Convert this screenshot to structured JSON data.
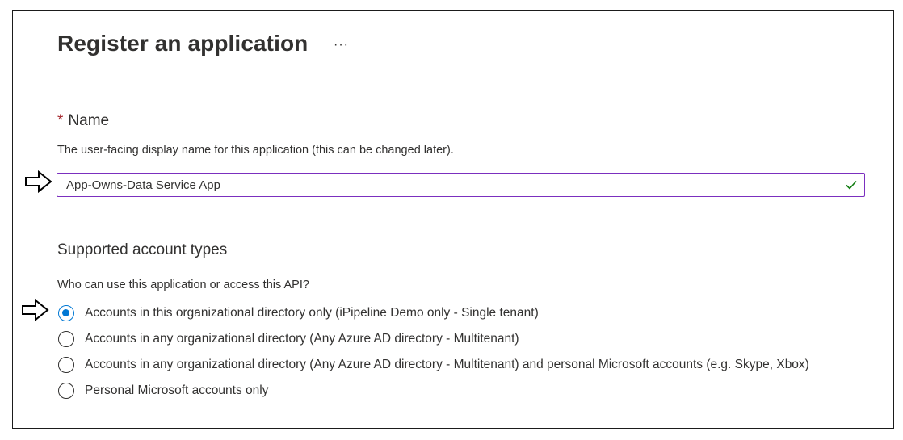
{
  "page": {
    "title": "Register an application",
    "more_label": "···"
  },
  "name_section": {
    "required_marker": "*",
    "label": "Name",
    "description": "The user-facing display name for this application (this can be changed later).",
    "input_value": "App-Owns-Data Service App",
    "valid_icon": "check-icon"
  },
  "account_types": {
    "label": "Supported account types",
    "question": "Who can use this application or access this API?",
    "selected_index": 0,
    "options": [
      {
        "label": "Accounts in this organizational directory only (iPipeline Demo only - Single tenant)",
        "checked": true
      },
      {
        "label": "Accounts in any organizational directory (Any Azure AD directory - Multitenant)",
        "checked": false
      },
      {
        "label": "Accounts in any organizational directory (Any Azure AD directory - Multitenant) and personal Microsoft accounts (e.g. Skype, Xbox)",
        "checked": false
      },
      {
        "label": "Personal Microsoft accounts only",
        "checked": false
      }
    ]
  },
  "colors": {
    "accent": "#0078d4",
    "input_border": "#7b2fbf",
    "valid_check": "#107c10",
    "required": "#a4262c"
  }
}
